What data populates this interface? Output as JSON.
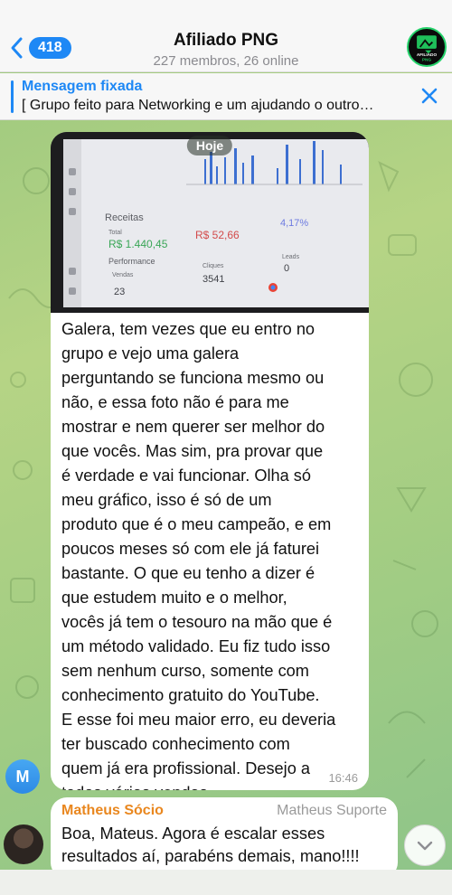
{
  "header": {
    "back_count": "418",
    "title": "Afiliado PNG",
    "subtitle": "227 membros, 26 online",
    "avatar_text": "AFILIADO PNG"
  },
  "pinned": {
    "label": "Mensagem fixada",
    "text": "[ Grupo feito para Networking e um ajudando o outro…"
  },
  "message": {
    "date_badge": "Hoje",
    "photo": {
      "receitas_label": "Receitas",
      "total_label": "Total",
      "total_value": "R$ 1.440,45",
      "resultado_value": "R$ 52,66",
      "percent_value": "4,17%",
      "performance_label": "Performance",
      "vendas_label": "Vendas",
      "vendas_value": "23",
      "cliques_label": "Cliques",
      "cliques_value": "3541",
      "leads_label": "Leads",
      "leads_value": "0"
    },
    "text": "Galera, tem vezes que eu entro no\ngrupo e vejo uma galera\nperguntando se funciona mesmo ou\nnão, e essa foto não é para me\nmostrar e nem querer ser melhor do\nque vocês. Mas sim, pra provar que\né verdade e vai funcionar. Olha só\nmeu gráfico, isso é só de um\nproduto que é o meu campeão, e em\npoucos meses só com ele já faturei\nbastante. O que eu tenho a dizer é\nque estudem muito e o melhor,\nvocês já tem o tesouro na mão que é\num método validado. Eu fiz tudo isso\nsem nenhum curso, somente com\nconhecimento gratuito do YouTube.\nE esse foi meu maior erro, eu deveria\nter buscado conhecimento com\nquem já era profissional. Desejo a\ntodos várias vendas.",
    "time": "16:46",
    "sender_initial": "M"
  },
  "reply": {
    "author": "Matheus Sócio",
    "role": "Matheus Suporte",
    "text": "Boa, Mateus. Agora é escalar esses\nresultados aí, parabéns demais, mano!!!!"
  },
  "colors": {
    "accent": "#1e88f5",
    "author_orange": "#e9871f",
    "green_value": "#7fd18b",
    "red_value": "#f08f8f"
  }
}
